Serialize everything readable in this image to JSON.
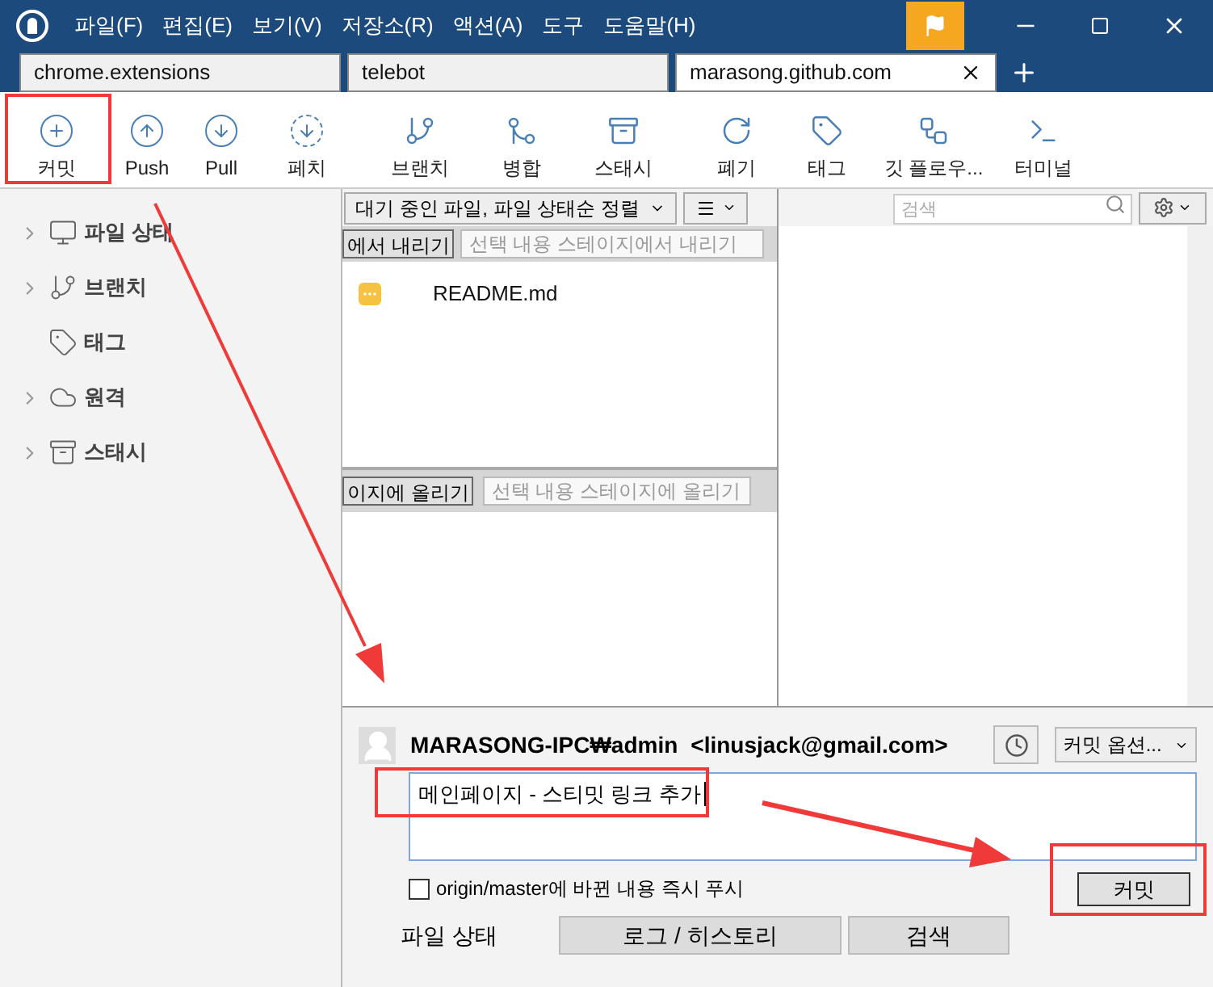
{
  "window": {
    "menus": [
      "파일(F)",
      "편집(E)",
      "보기(V)",
      "저장소(R)",
      "액션(A)",
      "도구",
      "도움말(H)"
    ]
  },
  "tabs": [
    {
      "label": "chrome.extensions",
      "selected": false
    },
    {
      "label": "telebot",
      "selected": false
    },
    {
      "label": "marasong.github.com",
      "selected": true
    }
  ],
  "toolbar": [
    "커밋",
    "Push",
    "Pull",
    "페치",
    "브랜치",
    "병합",
    "스태시",
    "폐기",
    "태그",
    "깃 플로우...",
    "터미널"
  ],
  "sidebar": {
    "items": [
      {
        "label": "파일 상태",
        "expandable": true
      },
      {
        "label": "브랜치",
        "expandable": true
      },
      {
        "label": "태그",
        "expandable": false
      },
      {
        "label": "원격",
        "expandable": true
      },
      {
        "label": "스태시",
        "expandable": true
      }
    ]
  },
  "file_pane": {
    "sort": "대기 중인 파일, 파일 상태순 정렬",
    "search": {
      "placeholder": "검색"
    },
    "staged": {
      "button": "에서 내리기",
      "placeholder": "선택 내용 스테이지에서 내리기",
      "files": [
        {
          "name": "README.md"
        }
      ]
    },
    "unstaged": {
      "button": "이지에 올리기",
      "placeholder": "선택 내용 스테이지에 올리기"
    }
  },
  "commit": {
    "author": "MARASONG-IPC₩admin",
    "email": "<linusjack@gmail.com>",
    "options": "커밋 옵션...",
    "message": "메인페이지 - 스티밋 링크 추가",
    "push": {
      "label": "origin/master에 바뀐 내용 즉시 푸시",
      "checked": false
    },
    "button": "커밋"
  },
  "bottom_tabs": [
    {
      "label": "파일 상태",
      "selected": true
    },
    {
      "label": "로그 / 히스토리",
      "selected": false
    },
    {
      "label": "검색",
      "selected": false
    }
  ]
}
